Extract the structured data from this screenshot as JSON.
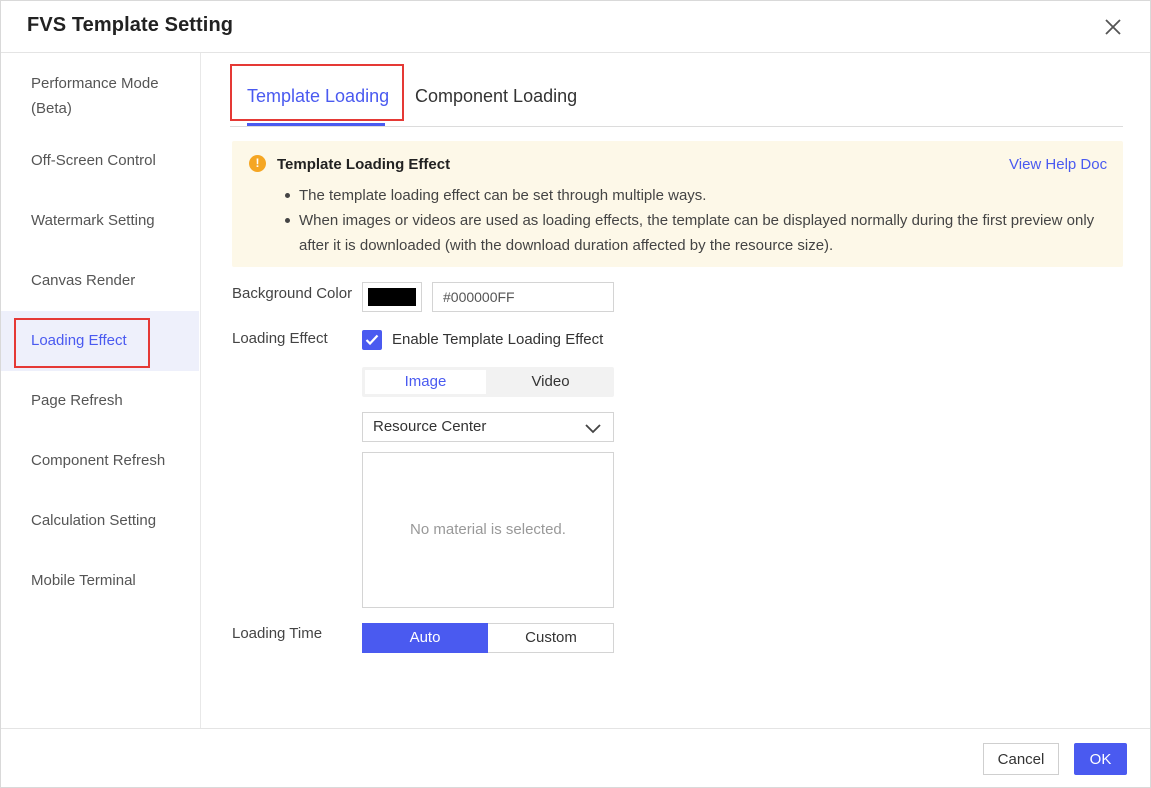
{
  "dialog": {
    "title": "FVS Template Setting",
    "close_icon": "close-icon"
  },
  "sidebar": {
    "items": [
      {
        "label": "Performance Mode (Beta)"
      },
      {
        "label": "Off-Screen Control"
      },
      {
        "label": "Watermark Setting"
      },
      {
        "label": "Canvas Render"
      },
      {
        "label": "Loading Effect",
        "active": true
      },
      {
        "label": "Page Refresh"
      },
      {
        "label": "Component Refresh"
      },
      {
        "label": "Calculation Setting"
      },
      {
        "label": "Mobile Terminal"
      }
    ]
  },
  "tabs": [
    {
      "label": "Template Loading",
      "active": true
    },
    {
      "label": "Component Loading"
    }
  ],
  "notice": {
    "icon": "warning-icon",
    "title": "Template Loading Effect",
    "link": "View Help Doc",
    "bullets": [
      "The template loading effect can be set through multiple ways.",
      "When images or videos are used as loading effects, the template can be displayed normally during the first preview only after it is downloaded (with the download duration affected by the resource size)."
    ]
  },
  "form": {
    "background_color": {
      "label": "Background Color",
      "swatch_color": "#000000",
      "value": "#000000FF"
    },
    "loading_effect": {
      "label": "Loading Effect",
      "checkbox_label": "Enable Template Loading Effect",
      "checked": true,
      "media_types": [
        "Image",
        "Video"
      ],
      "selected_media_type": "Image",
      "source_select": "Resource Center",
      "empty_text": "No material is selected."
    },
    "loading_time": {
      "label": "Loading Time",
      "options": [
        "Auto",
        "Custom"
      ],
      "selected": "Auto"
    }
  },
  "footer": {
    "cancel": "Cancel",
    "ok": "OK"
  },
  "colors": {
    "accent": "#4a5af0",
    "highlight_box": "#e53935",
    "notice_bg": "#fdf8e8",
    "warning": "#f5a623"
  }
}
